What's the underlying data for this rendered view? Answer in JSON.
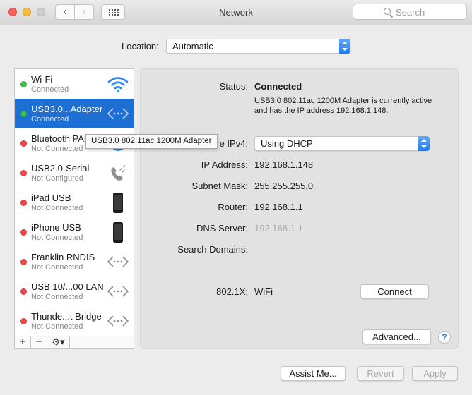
{
  "window": {
    "title": "Network",
    "search_placeholder": "Search",
    "nav_back": "‹",
    "nav_forward": "›"
  },
  "location": {
    "label": "Location:",
    "value": "Automatic"
  },
  "services": [
    {
      "name": "Wi-Fi",
      "status": "Connected",
      "state": "connected",
      "icon": "wifi-icon"
    },
    {
      "name": "USB3.0...Adapter",
      "status": "Connected",
      "state": "connected",
      "icon": "ethernet-arrows-icon",
      "selected": true
    },
    {
      "name": "Bluetooth PAN",
      "status": "Not Connected",
      "state": "disconnected",
      "icon": "bluetooth-icon"
    },
    {
      "name": "USB2.0-Serial",
      "status": "Not Configured",
      "state": "disconnected",
      "icon": "phone-modem-icon"
    },
    {
      "name": "iPad USB",
      "status": "Not Connected",
      "state": "disconnected",
      "icon": "ipad-icon"
    },
    {
      "name": "iPhone USB",
      "status": "Not Connected",
      "state": "disconnected",
      "icon": "iphone-icon"
    },
    {
      "name": "Franklin RNDIS",
      "status": "Not Connected",
      "state": "disconnected",
      "icon": "ethernet-arrows-icon"
    },
    {
      "name": "USB 10/...00 LAN",
      "status": "Not Connected",
      "state": "disconnected",
      "icon": "ethernet-arrows-icon"
    },
    {
      "name": "Thunde...t Bridge",
      "status": "Not Connected",
      "state": "disconnected",
      "icon": "ethernet-arrows-icon"
    }
  ],
  "sidebar_tools": {
    "add": "+",
    "remove": "−",
    "gear": "⚙▾"
  },
  "tooltip": "USB3.0 802.11ac 1200M Adapter",
  "detail": {
    "status_label": "Status:",
    "status_value": "Connected",
    "status_description": "USB3.0 802.11ac 1200M Adapter is currently active and has the IP address 192.168.1.148.",
    "configure_label": "re IPv4:",
    "configure_value": "Using DHCP",
    "ip_label": "IP Address:",
    "ip_value": "192.168.1.148",
    "subnet_label": "Subnet Mask:",
    "subnet_value": "255.255.255.0",
    "router_label": "Router:",
    "router_value": "192.168.1.1",
    "dns_label": "DNS Server:",
    "dns_value": "192.168.1.1",
    "search_domains_label": "Search Domains:",
    "x8021_label": "802.1X:",
    "x8021_value": "WiFi",
    "connect_button": "Connect",
    "advanced_button": "Advanced...",
    "help_button": "?"
  },
  "footer": {
    "assist_button": "Assist Me...",
    "revert_button": "Revert",
    "apply_button": "Apply"
  },
  "colors": {
    "selection": "#1d6fd4",
    "connected": "#38c748",
    "disconnected": "#f44747",
    "accent": "#1c7cf4"
  }
}
